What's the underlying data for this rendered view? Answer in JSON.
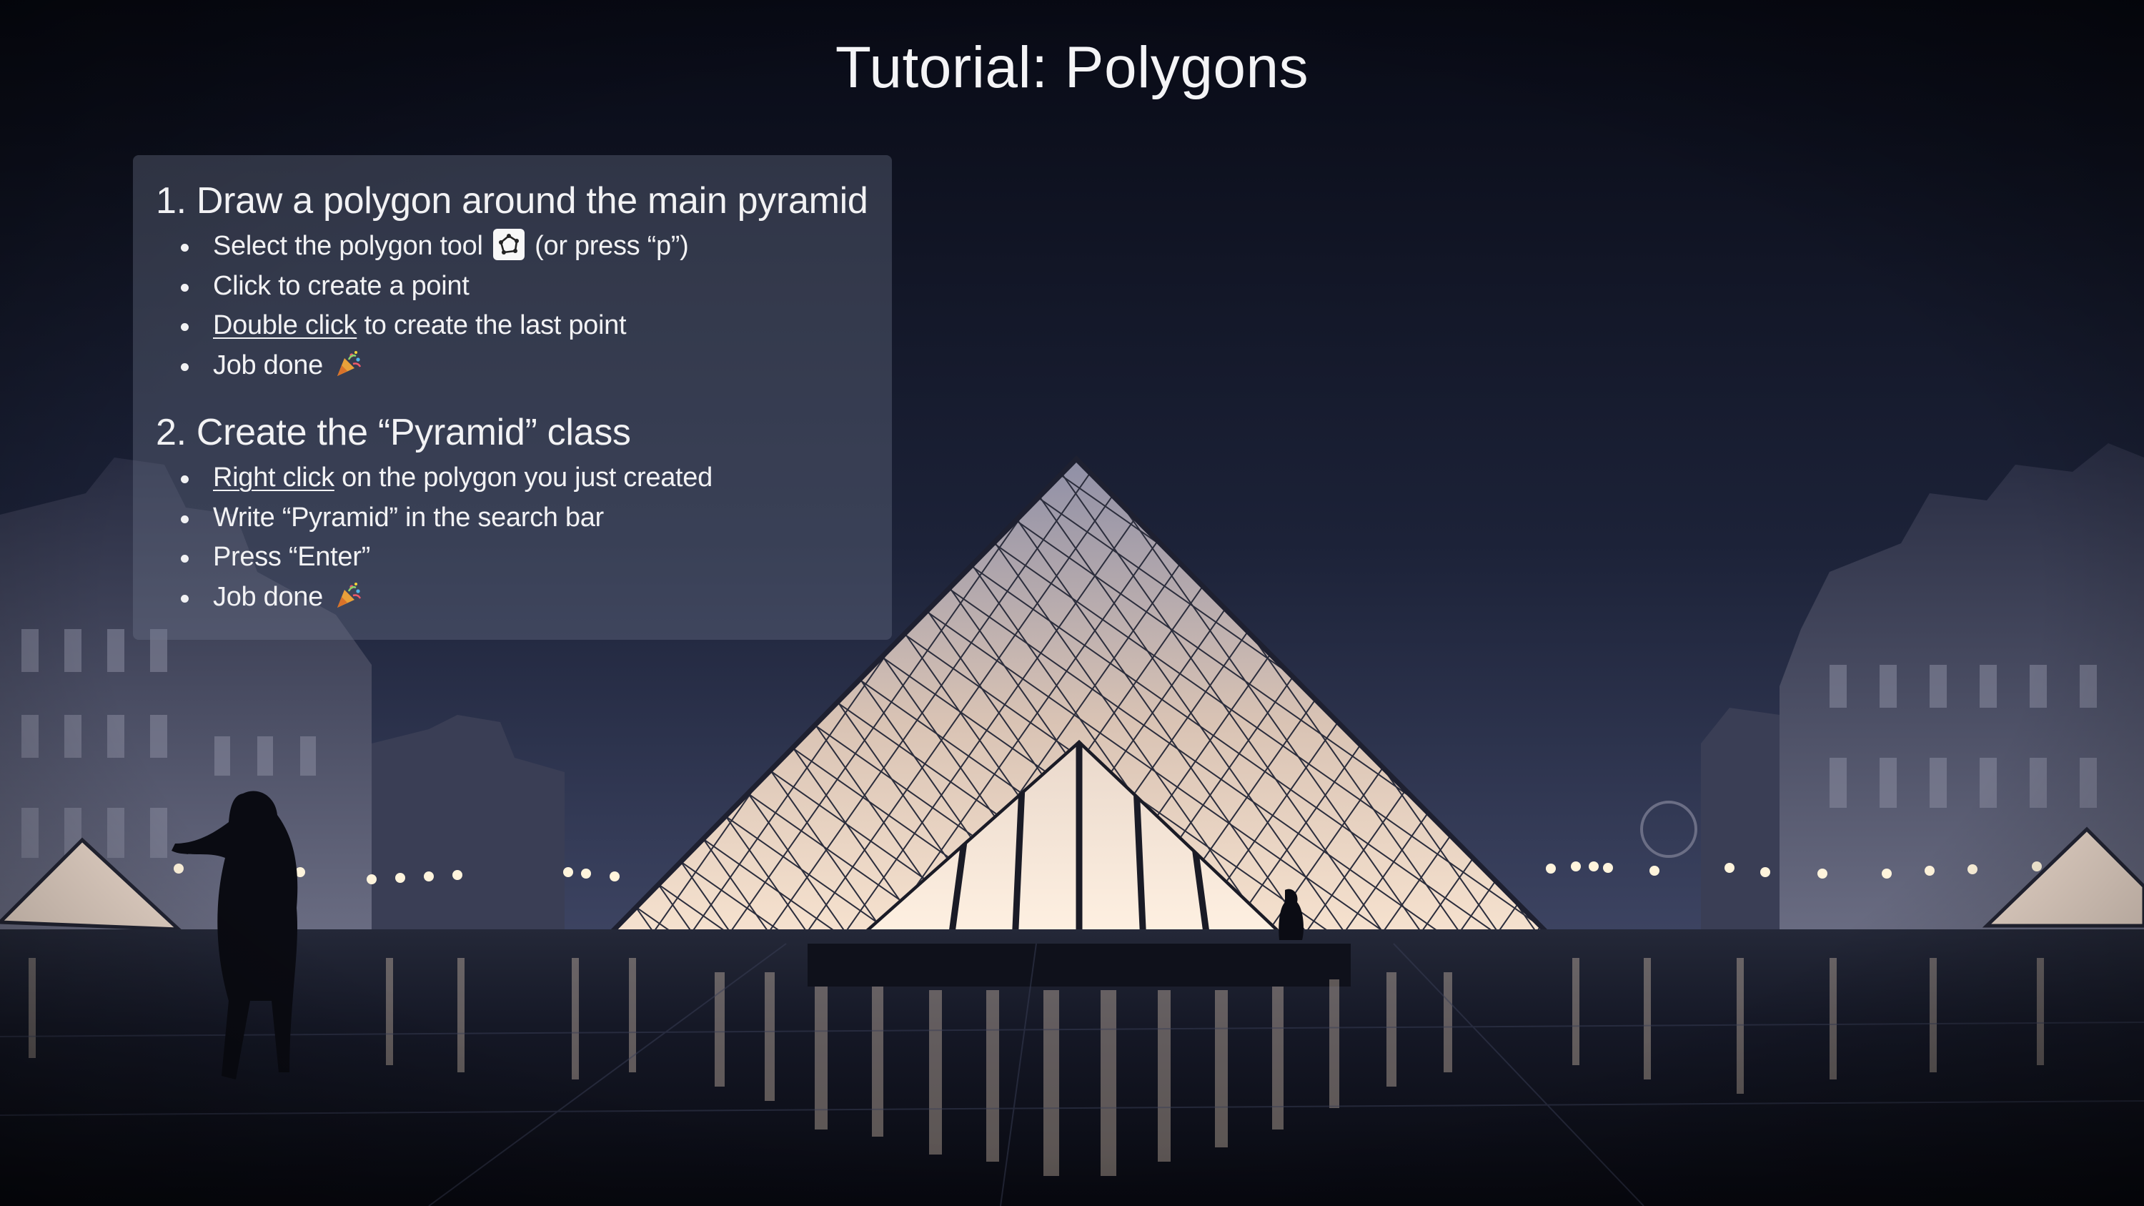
{
  "page": {
    "title": "Tutorial: Polygons"
  },
  "tutorial": {
    "steps": [
      {
        "heading": "1. Draw a polygon around the main pyramid",
        "bullets": {
          "select_tool_before": "Select the polygon tool",
          "select_tool_after": "(or press “p”)",
          "click_point": "Click to create a point",
          "double_click_link": "Double click",
          "double_click_rest": " to create the last point",
          "job_done": "Job done"
        }
      },
      {
        "heading": "2. Create the “Pyramid” class",
        "bullets": {
          "right_click_link": "Right click",
          "right_click_rest": " on the polygon you just created",
          "write_pyramid": "Write “Pyramid” in the search bar",
          "press_enter": "Press “Enter”",
          "job_done": "Job done"
        }
      }
    ]
  },
  "icons": {
    "polygon_tool": "polygon-tool-icon",
    "celebration": "party-popper-icon"
  },
  "colors": {
    "title_text": "#f4f4f6",
    "panel_bg": "rgba(112,120,140,0.36)",
    "sky_top": "#0a0c18",
    "sky_bottom": "#39405c",
    "pyramid_glow": "#f1d9c4"
  }
}
